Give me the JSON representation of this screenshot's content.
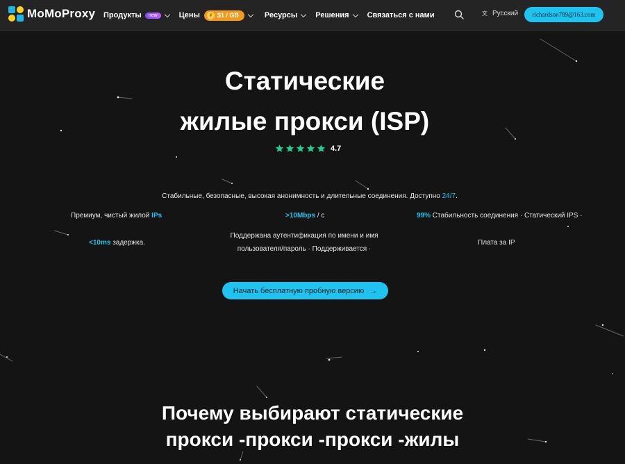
{
  "nav": {
    "logo": "MoMoProxy",
    "products": "Продукты",
    "new_badge": "new",
    "prices": "Цены",
    "price_badge": "$1 / GB",
    "resources": "Ресурсы",
    "solutions": "Решения",
    "contact": "Связаться с нами",
    "language": "Русский",
    "user_email": "richardson789@163.com"
  },
  "hero": {
    "title_line1": "Статические",
    "title_line2": "жилые прокси (ISP)",
    "rating": "4.7",
    "stars": 5,
    "subtitle_text": "Стабильные, безопасные, высокая анонимность и длительные соединения. Доступно ",
    "subtitle_highlight": "24/7",
    "subtitle_end": "."
  },
  "features": {
    "f1_text": "Премиум, чистый жилой ",
    "f1_hl": "IPs",
    "f2_hl": ">10Mbps",
    "f2_text": " / с",
    "f3_hl": "99%",
    "f3_text": " Стабильность соединения · Статический IPS ·",
    "f4_hl": "<10ms",
    "f4_text": " задержка.",
    "f5_line1": "Поддержана аутентификация по имени и имя",
    "f5_line2": "пользователя/пароль · Поддерживается ·",
    "f6_text": "Плата за IP"
  },
  "cta": {
    "label": "Начать бесплатную пробную версию",
    "arrow": "→"
  },
  "why": {
    "line1": "Почему выбирают статические",
    "line2": "прокси -прокси -прокси -жилы"
  },
  "colors": {
    "accent": "#1ec4ef",
    "star": "#1fd18e",
    "price_badge": "#f39a1b",
    "background": "#141414"
  }
}
